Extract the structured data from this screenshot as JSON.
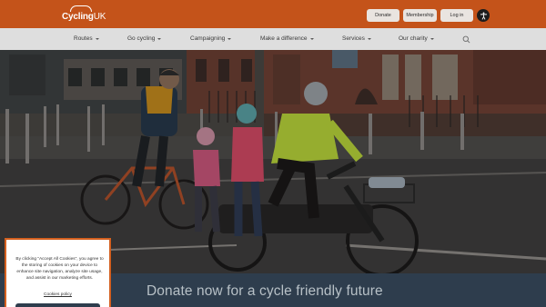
{
  "header": {
    "logo": {
      "text_main": "Cycling",
      "text_suffix": "UK"
    },
    "buttons": {
      "donate": "Donate",
      "membership": "Membership",
      "login": "Log in"
    },
    "accessibility_icon": "accessibility-icon"
  },
  "nav": {
    "items": [
      "Routes",
      "Go cycling",
      "Campaigning",
      "Make a difference",
      "Services",
      "Our charity"
    ],
    "search_icon": "search-icon"
  },
  "hero": {
    "banner_text": "Donate now for a cycle friendly future"
  },
  "cookie_banner": {
    "message": "By clicking “Accept All Cookies”, you agree to the storing of cookies on your device to enhance site navigation, analyze site usage, and assist in our marketing efforts.",
    "policy_link": "Cookies policy"
  },
  "colors": {
    "brand_orange": "#c4531a",
    "nav_bg": "#dedede",
    "navy": "#2e3d4d",
    "high_vis_yellow": "#b8d43a",
    "high_vis_pink": "#e8577a"
  }
}
